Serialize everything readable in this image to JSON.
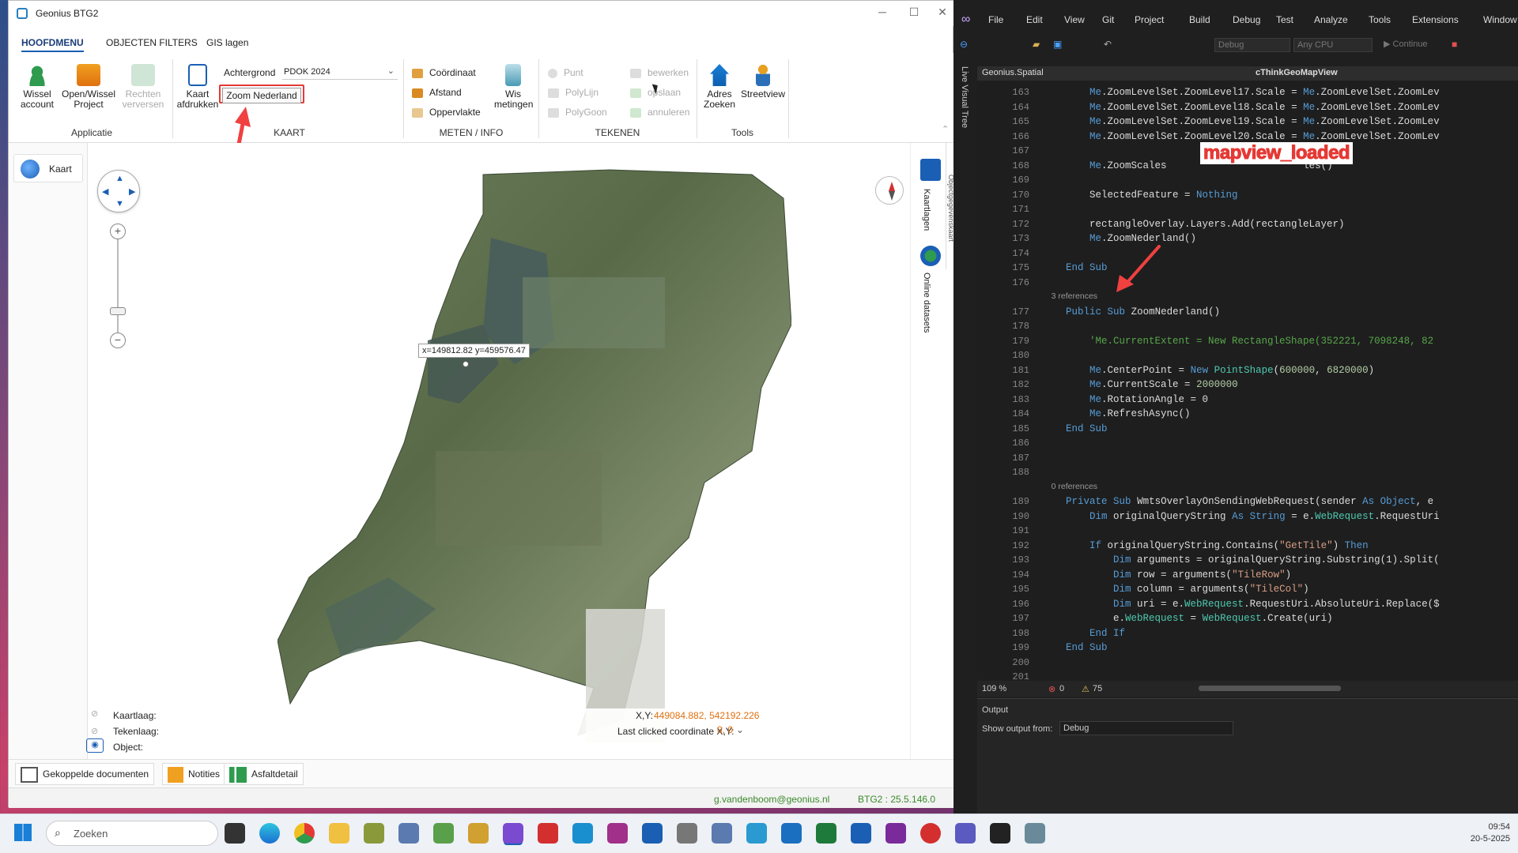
{
  "app": {
    "title": "Geonius BTG2",
    "tabs": [
      "HOOFDMENU",
      "OBJECTEN FILTERS",
      "GIS lagen"
    ],
    "ribbon": {
      "applicatie": {
        "group": "Applicatie",
        "wissel_account": "Wissel account",
        "open_wissel_project": "Open/Wissel Project",
        "rechten_verversen": "Rechten verversen"
      },
      "kaart": {
        "group": "KAART",
        "kaart_afdrukken": "Kaart afdrukken",
        "achtergrond_label": "Achtergrond",
        "achtergrond_value": "PDOK 2024",
        "zoom_nederland": "Zoom Nederland"
      },
      "meten": {
        "group": "METEN / INFO",
        "coordinaat": "Coördinaat",
        "afstand": "Afstand",
        "oppervlakte": "Oppervlakte",
        "wis_metingen": "Wis metingen"
      },
      "tekenen": {
        "group": "TEKENEN",
        "punt": "Punt",
        "polylijn": "PolyLijn",
        "polygoon": "PolyGoon",
        "bewerken": "bewerken",
        "opslaan": "opslaan",
        "annuleren": "annuleren"
      },
      "tools": {
        "group": "Tools",
        "adres_zoeken": "Adres Zoeken",
        "streetview": "Streetview"
      }
    },
    "sidebar": {
      "kaart": "Kaart"
    },
    "map": {
      "coord_tooltip": "x=149812.82 y=459576.47",
      "kaartlaag_label": "Kaartlaag:",
      "tekenlaag_label": "Tekenlaag:",
      "object_label": "Object:",
      "xy_label": "X,Y:",
      "xy_value": "449084.882, 542192.226",
      "last_clicked_label": "Last clicked coordinate X,Y:",
      "last_clicked_value": "0, 0"
    },
    "right_tabs": {
      "kaartlagen": "Kaartlagen",
      "online_datasets": "Online datasets",
      "objectgegevens": "Objectgegevenskaart"
    },
    "bottom": {
      "gekoppelde": "Gekoppelde documenten",
      "notities": "Notities",
      "asfaltdetail": "Asfaltdetail"
    },
    "footer": {
      "user": "g.vandenboom@geonius.nl",
      "version": "BTG2 : 25.5.146.0"
    }
  },
  "vs": {
    "menu": [
      "File",
      "Edit",
      "View",
      "Git",
      "Project",
      "Build",
      "Debug",
      "Test",
      "Analyze",
      "Tools",
      "Extensions",
      "Window",
      "Help"
    ],
    "toolbar": {
      "config": "Debug",
      "platform": "Any CPU",
      "continue": "Continue"
    },
    "doc": {
      "project": "Geonius.Spatial",
      "member": "cThinkGeoMapView"
    },
    "annotation": "mapview_loaded",
    "live_visual_tree": "Live Visual Tree",
    "lines": [
      {
        "n": "163",
        "t": "        Me.ZoomLevelSet.ZoomLevel17.Scale = Me.ZoomLevelSet.ZoomLev"
      },
      {
        "n": "164",
        "t": "        Me.ZoomLevelSet.ZoomLevel18.Scale = Me.ZoomLevelSet.ZoomLev"
      },
      {
        "n": "165",
        "t": "        Me.ZoomLevelSet.ZoomLevel19.Scale = Me.ZoomLevelSet.ZoomLev"
      },
      {
        "n": "166",
        "t": "        Me.ZoomLevelSet.ZoomLevel20.Scale = Me.ZoomLevelSet.ZoomLev"
      },
      {
        "n": "167",
        "t": ""
      },
      {
        "n": "168",
        "t": "        Me.ZoomScales                       les()"
      },
      {
        "n": "169",
        "t": ""
      },
      {
        "n": "170",
        "t": "        SelectedFeature = Nothing"
      },
      {
        "n": "171",
        "t": ""
      },
      {
        "n": "172",
        "t": "        rectangleOverlay.Layers.Add(rectangleLayer)"
      },
      {
        "n": "173",
        "t": "        Me.ZoomNederland()"
      },
      {
        "n": "174",
        "t": ""
      },
      {
        "n": "175",
        "t": "    End Sub"
      },
      {
        "n": "176",
        "t": ""
      },
      {
        "n": "",
        "t": "    3 references"
      },
      {
        "n": "177",
        "t": "    Public Sub ZoomNederland()"
      },
      {
        "n": "178",
        "t": ""
      },
      {
        "n": "179",
        "t": "        'Me.CurrentExtent = New RectangleShape(352221, 7098248, 82"
      },
      {
        "n": "180",
        "t": ""
      },
      {
        "n": "181",
        "t": "        Me.CenterPoint = New PointShape(600000, 6820000)"
      },
      {
        "n": "182",
        "t": "        Me.CurrentScale = 2000000"
      },
      {
        "n": "183",
        "t": "        Me.RotationAngle = 0"
      },
      {
        "n": "184",
        "t": "        Me.RefreshAsync()"
      },
      {
        "n": "185",
        "t": "    End Sub"
      },
      {
        "n": "186",
        "t": ""
      },
      {
        "n": "187",
        "t": ""
      },
      {
        "n": "188",
        "t": ""
      },
      {
        "n": "",
        "t": "    0 references"
      },
      {
        "n": "189",
        "t": "    Private Sub WmtsOverlayOnSendingWebRequest(sender As Object, e"
      },
      {
        "n": "190",
        "t": "        Dim originalQueryString As String = e.WebRequest.RequestUri"
      },
      {
        "n": "191",
        "t": ""
      },
      {
        "n": "192",
        "t": "        If originalQueryString.Contains(\"GetTile\") Then"
      },
      {
        "n": "193",
        "t": "            Dim arguments = originalQueryString.Substring(1).Split("
      },
      {
        "n": "194",
        "t": "            Dim row = arguments(\"TileRow\")"
      },
      {
        "n": "195",
        "t": "            Dim column = arguments(\"TileCol\")"
      },
      {
        "n": "196",
        "t": "            Dim uri = e.WebRequest.RequestUri.AbsoluteUri.Replace($"
      },
      {
        "n": "197",
        "t": "            e.WebRequest = WebRequest.Create(uri)"
      },
      {
        "n": "198",
        "t": "        End If"
      },
      {
        "n": "199",
        "t": "    End Sub"
      },
      {
        "n": "200",
        "t": ""
      },
      {
        "n": "201",
        "t": ""
      }
    ],
    "status": {
      "zoom": "109 %",
      "errors": "0",
      "warnings": "75"
    },
    "output": {
      "title": "Output",
      "show_from_label": "Show output from:",
      "show_from_value": "Debug"
    }
  },
  "taskbar": {
    "search_placeholder": "Zoeken",
    "time": "09:54",
    "date": "20-5-2025"
  },
  "colors": {
    "accent": "#1a5fb4",
    "annotation": "#e53935",
    "vs_bg": "#1e1e1e"
  }
}
